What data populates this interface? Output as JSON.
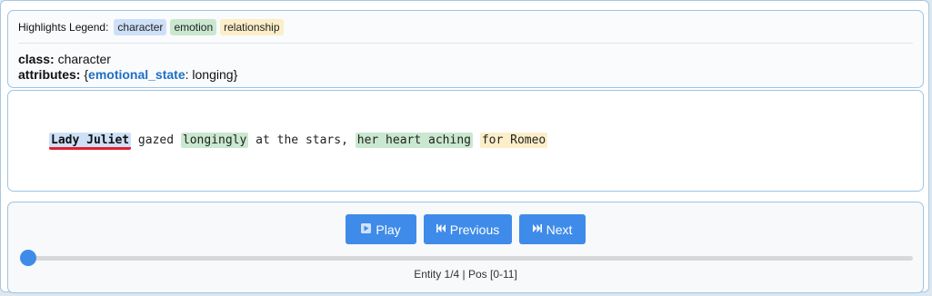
{
  "legend": {
    "title": "Highlights Legend:",
    "items": [
      {
        "label": "character",
        "color": "#cde0f7"
      },
      {
        "label": "emotion",
        "color": "#c9e8cf"
      },
      {
        "label": "relationship",
        "color": "#fbeec8"
      }
    ]
  },
  "details": {
    "class_label": "class:",
    "class_value": "character",
    "attributes_label": "attributes:",
    "attr_open": "{",
    "attr_key": "emotional_state",
    "attr_sep": ": ",
    "attr_value": "longing",
    "attr_close": "}"
  },
  "sentence": {
    "s1": "Lady Juliet",
    "s2": " gazed ",
    "s3": "longingly",
    "s4": " at the stars, ",
    "s5": "her heart aching",
    "s6": " ",
    "s7": "for Romeo"
  },
  "controls": {
    "play_label": "Play",
    "previous_label": "Previous",
    "next_label": "Next",
    "slider_value": 0.0,
    "status": "Entity 1/4 | Pos [0-11]"
  },
  "colors": {
    "accent": "#3f8be9",
    "underline": "#e3202e"
  }
}
